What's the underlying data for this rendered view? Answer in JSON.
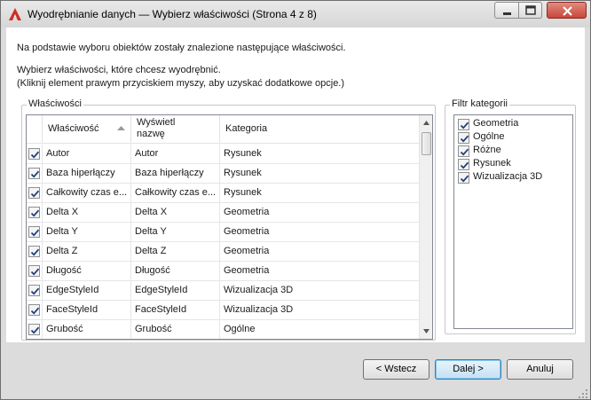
{
  "window": {
    "title": "Wyodrębnianie danych — Wybierz właściwości (Strona 4 z 8)"
  },
  "info": {
    "line1": "Na podstawie wyboru obiektów zostały znalezione następujące właściwości.",
    "line2": "Wybierz właściwości, które chcesz wyodrębnić.",
    "line3": "(Kliknij element prawym przyciskiem myszy, aby uzyskać dodatkowe opcje.)"
  },
  "properties_group": {
    "legend": "Właściwości",
    "columns": {
      "property": "Właściwość",
      "display_line1": "Wyświetl",
      "display_line2": "nazwę",
      "category": "Kategoria"
    },
    "rows": [
      {
        "property": "Autor",
        "display": "Autor",
        "category": "Rysunek",
        "checked": true
      },
      {
        "property": "Baza hiperłączy",
        "display": "Baza hiperłączy",
        "category": "Rysunek",
        "checked": true
      },
      {
        "property": "Całkowity czas e...",
        "display": "Całkowity czas e...",
        "category": "Rysunek",
        "checked": true
      },
      {
        "property": "Delta X",
        "display": "Delta X",
        "category": "Geometria",
        "checked": true
      },
      {
        "property": "Delta Y",
        "display": "Delta Y",
        "category": "Geometria",
        "checked": true
      },
      {
        "property": "Delta Z",
        "display": "Delta Z",
        "category": "Geometria",
        "checked": true
      },
      {
        "property": "Długość",
        "display": "Długość",
        "category": "Geometria",
        "checked": true
      },
      {
        "property": "EdgeStyleId",
        "display": "EdgeStyleId",
        "category": "Wizualizacja 3D",
        "checked": true
      },
      {
        "property": "FaceStyleId",
        "display": "FaceStyleId",
        "category": "Wizualizacja 3D",
        "checked": true
      },
      {
        "property": "Grubość",
        "display": "Grubość",
        "category": "Ogólne",
        "checked": true
      }
    ]
  },
  "filter_group": {
    "legend": "Filtr kategorii",
    "items": [
      {
        "label": "Geometria",
        "checked": true
      },
      {
        "label": "Ogólne",
        "checked": true
      },
      {
        "label": "Różne",
        "checked": true
      },
      {
        "label": "Rysunek",
        "checked": true
      },
      {
        "label": "Wizualizacja 3D",
        "checked": true
      }
    ]
  },
  "buttons": {
    "back": "< Wstecz",
    "next": "Dalej >",
    "cancel": "Anuluj"
  },
  "colors": {
    "accent": "#3c7fb1",
    "app_icon": "#d22b25"
  },
  "icons": {
    "app": "autocad-a-icon",
    "sort": "sort-ascending-icon",
    "check": "checkmark-icon"
  }
}
